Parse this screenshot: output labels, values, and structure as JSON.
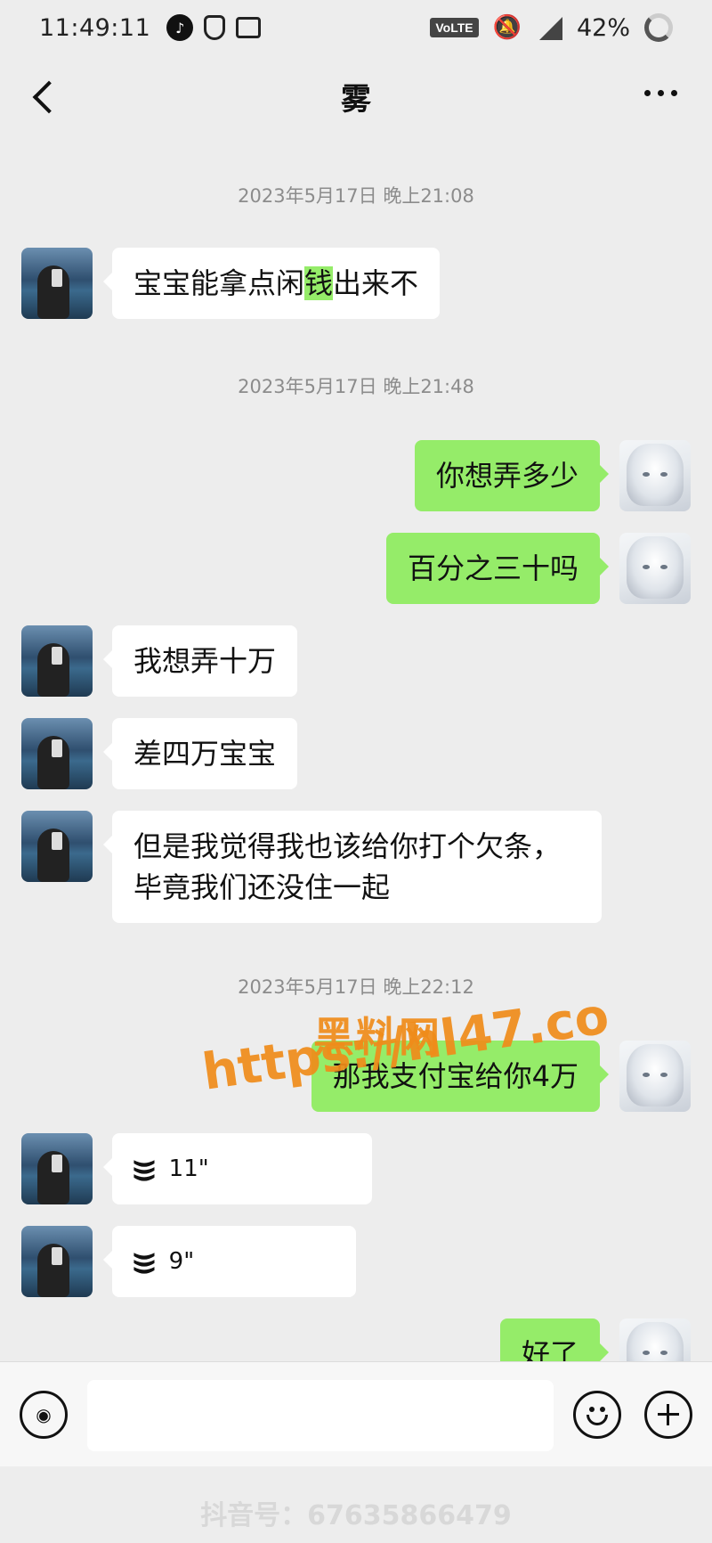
{
  "status_bar": {
    "time": "11:49:11",
    "network": "VoLTE",
    "signal": "4G",
    "battery": "42%"
  },
  "header": {
    "title": "雾"
  },
  "timestamps": [
    "2023年5月17日 晚上21:08",
    "2023年5月17日 晚上21:48",
    "2023年5月17日 晚上22:12"
  ],
  "messages": [
    {
      "side": "left",
      "pre": "宝宝能拿点闲",
      "highlight": "钱",
      "post": "出来不"
    },
    {
      "side": "right",
      "text": "你想弄多少"
    },
    {
      "side": "right",
      "text": "百分之三十吗"
    },
    {
      "side": "left",
      "text": "我想弄十万"
    },
    {
      "side": "left",
      "text": "差四万宝宝"
    },
    {
      "side": "left",
      "line1": "但是我觉得我也该给你打个欠条，",
      "line2": "毕竟我们还没住一起"
    },
    {
      "side": "right",
      "text": "那我支付宝给你4万"
    },
    {
      "side": "left",
      "type": "voice",
      "duration": "11\""
    },
    {
      "side": "left",
      "type": "voice",
      "duration": "9\""
    },
    {
      "side": "right",
      "text": "好了"
    }
  ],
  "watermark": {
    "site_name": "黑料网",
    "url": "https://hl47.co"
  },
  "input_bar": {
    "placeholder": ""
  },
  "footer_watermark": "抖音号：67635866479"
}
